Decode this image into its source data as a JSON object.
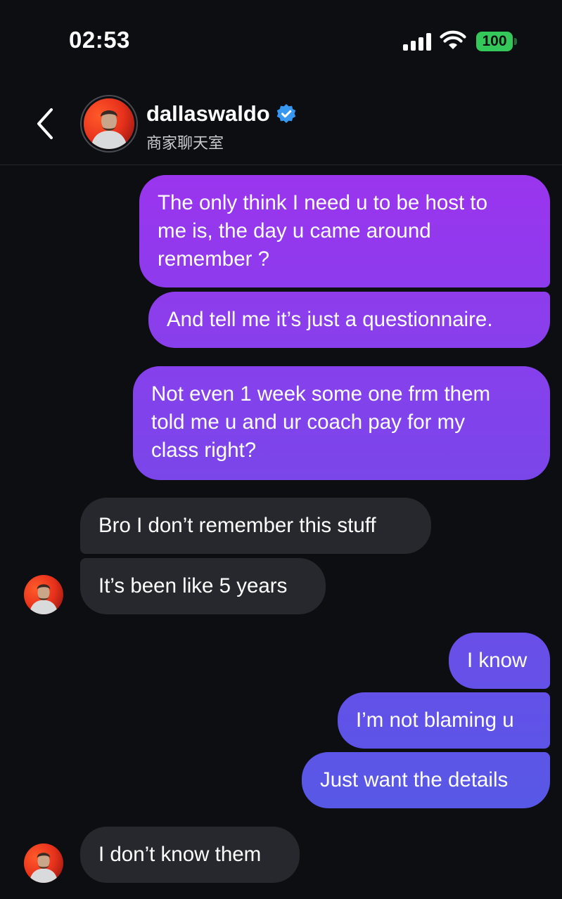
{
  "status": {
    "time": "02:53",
    "battery": "100",
    "icons": [
      "signal-icon",
      "wifi-icon",
      "battery-icon"
    ]
  },
  "header": {
    "username": "dallaswaldo",
    "subtitle": "商家聊天室",
    "verified": true,
    "icons": [
      "back-chevron-icon",
      "verified-badge-icon"
    ]
  },
  "messages": [
    {
      "from": "me",
      "lines": [
        "The only think I need u to be host to",
        "me is, the day u came around",
        "remember ?"
      ]
    },
    {
      "from": "me",
      "lines": [
        "And tell me it’s just a questionnaire."
      ]
    },
    {
      "from": "me",
      "lines": [
        "Not even 1 week some one frm them",
        "told me u and ur coach pay for my",
        "class right?"
      ]
    },
    {
      "from": "them",
      "lines": [
        "Bro I don’t remember this stuff"
      ]
    },
    {
      "from": "them",
      "lines": [
        "It’s been like 5 years"
      ]
    },
    {
      "from": "me",
      "lines": [
        "I know"
      ]
    },
    {
      "from": "me",
      "lines": [
        "I’m not blaming u"
      ]
    },
    {
      "from": "me",
      "lines": [
        "Just want the details"
      ]
    },
    {
      "from": "them",
      "lines": [
        "I don’t know them"
      ]
    }
  ],
  "colors": {
    "background": "#0d0e12",
    "sent_top": "#9b35ee",
    "sent_bottom": "#5658e6",
    "received": "#27282d",
    "verified": "#3897f0",
    "battery": "#34c759"
  }
}
